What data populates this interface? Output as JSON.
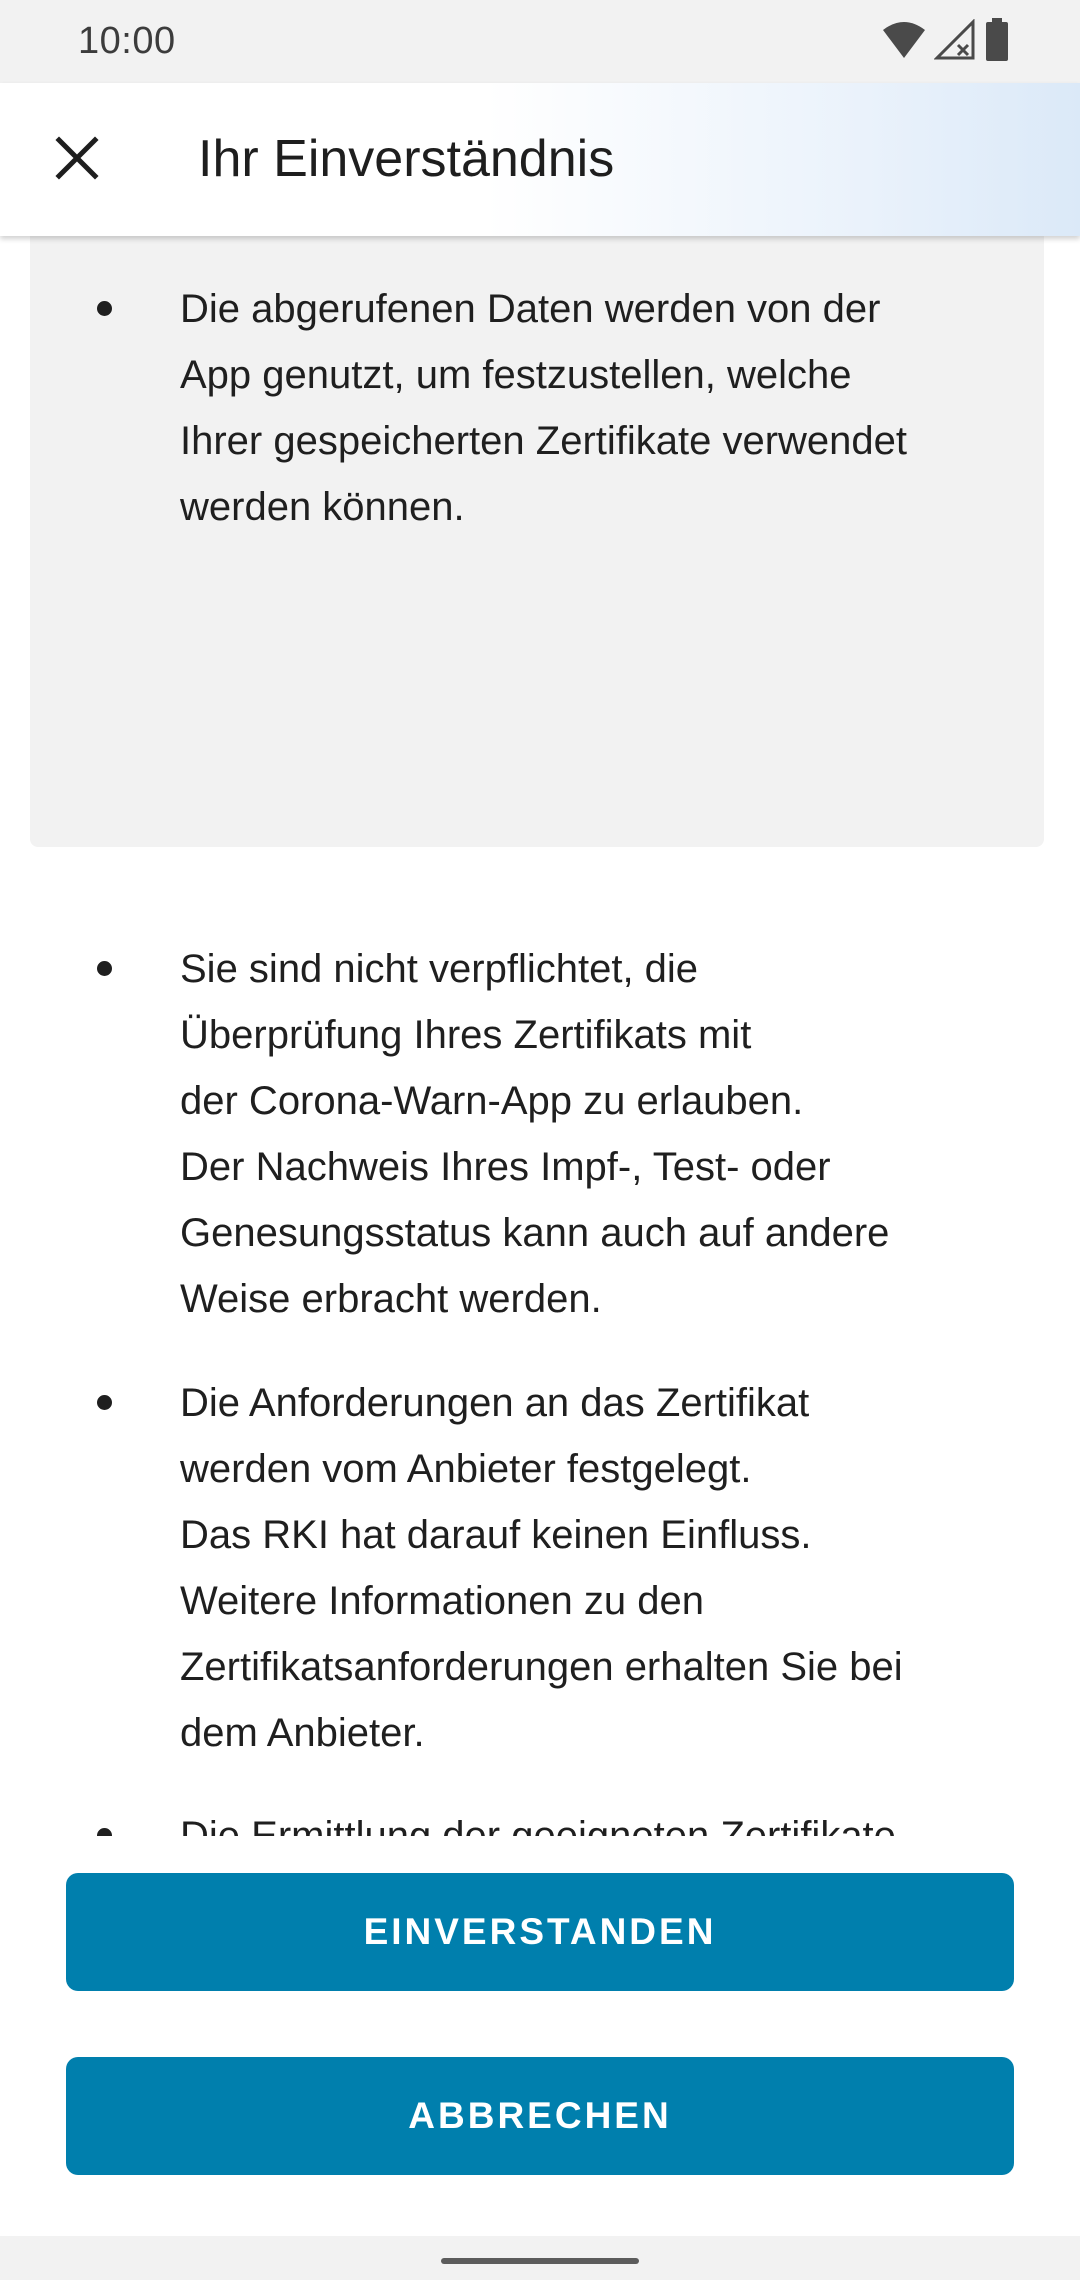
{
  "status_bar": {
    "time": "10:00",
    "icons": [
      "wifi-icon",
      "cellular-no-signal-icon",
      "battery-icon"
    ]
  },
  "app_bar": {
    "title": "Ihr Einverständnis",
    "close_icon": "close-icon"
  },
  "content": {
    "boxed_bullets": [
      "Die abgerufenen Daten werden von der\nApp genutzt, um festzustellen, welche\nIhrer gespeicherten Zertifikate verwendet\nwerden können."
    ],
    "bullets": [
      "Sie sind nicht verpflichtet, die\nÜberprüfung Ihres Zertifikats mit\nder Corona-Warn-App zu erlauben.\nDer Nachweis Ihres Impf-, Test- oder\nGenesungsstatus kann auch auf andere\nWeise erbracht werden.",
      "Die Anforderungen an das Zertifikat\nwerden vom Anbieter festgelegt.\nDas RKI hat darauf keinen Einfluss.\nWeitere Informationen zu den\nZertifikatsanforderungen erhalten Sie bei\ndem Anbieter.",
      "Die Ermittlung der geeigneten Zertifikate\nerfolgt lokal auf Ihrem Smartphone. Es\nwerden dabei keine Daten an das RKI\noder den Anbieter übermittelt."
    ]
  },
  "buttons": {
    "agree_label": "EINVERSTANDEN",
    "cancel_label": "ABBRECHEN"
  },
  "colors": {
    "primary_button": "#007fad",
    "box_background": "#f2f2f2",
    "status_bar_background": "#f2f2f2"
  }
}
